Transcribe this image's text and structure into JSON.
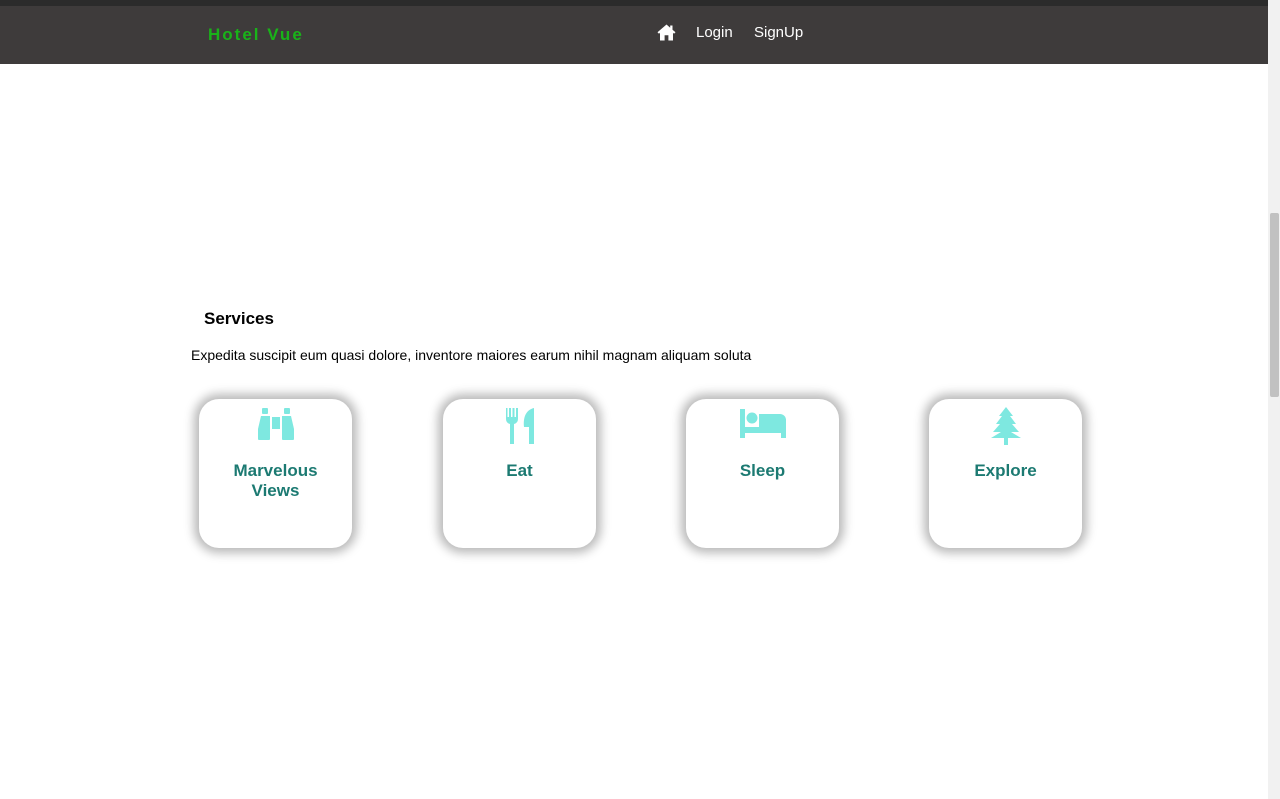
{
  "navbar": {
    "brand": "Hotel Vue",
    "home_icon": "home-icon",
    "links": [
      {
        "label": "Login"
      },
      {
        "label": "SignUp"
      }
    ]
  },
  "services": {
    "title": "Services",
    "description": "Expedita suscipit eum quasi dolore, inventore maiores earum nihil magnam aliquam soluta",
    "cards": [
      {
        "title": "Marvelous Views",
        "icon": "binoculars-icon"
      },
      {
        "title": "Eat",
        "icon": "utensils-icon"
      },
      {
        "title": "Sleep",
        "icon": "bed-icon"
      },
      {
        "title": "Explore",
        "icon": "tree-icon"
      }
    ]
  },
  "colors": {
    "navbar_bg": "#3e3b3b",
    "brand": "#19b319",
    "card_title": "#1c7a72",
    "icon": "#7ee8e0"
  }
}
